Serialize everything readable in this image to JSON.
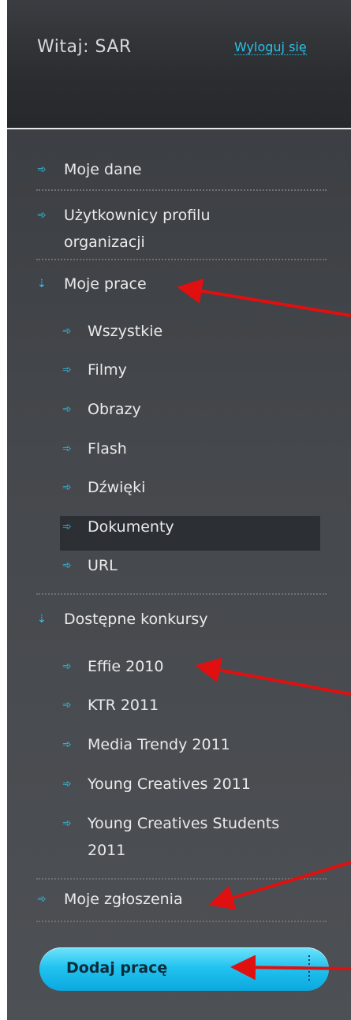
{
  "header": {
    "greeting": "Witaj: SAR",
    "logout_label": "Wyloguj się"
  },
  "menu": {
    "my_data": "Moje dane",
    "profile_users": "Użytkownicy profilu",
    "profile_users_2": "organizacji",
    "my_works": "Moje prace",
    "my_works_items": [
      "Wszystkie",
      "Filmy",
      "Obrazy",
      "Flash",
      "Dźwięki",
      "Dokumenty",
      "URL"
    ],
    "contests": "Dostępne konkursy",
    "contest_items": [
      "Effie 2010",
      "KTR 2011",
      "Media Trendy 2011",
      "Young Creatives 2011",
      "Young Creatives Students",
      "2011"
    ],
    "my_submissions": "Moje zgłoszenia"
  },
  "add_button": {
    "label": "Dodaj pracę"
  },
  "colors": {
    "accent": "#27c3ec",
    "arrow": "#e01010"
  }
}
